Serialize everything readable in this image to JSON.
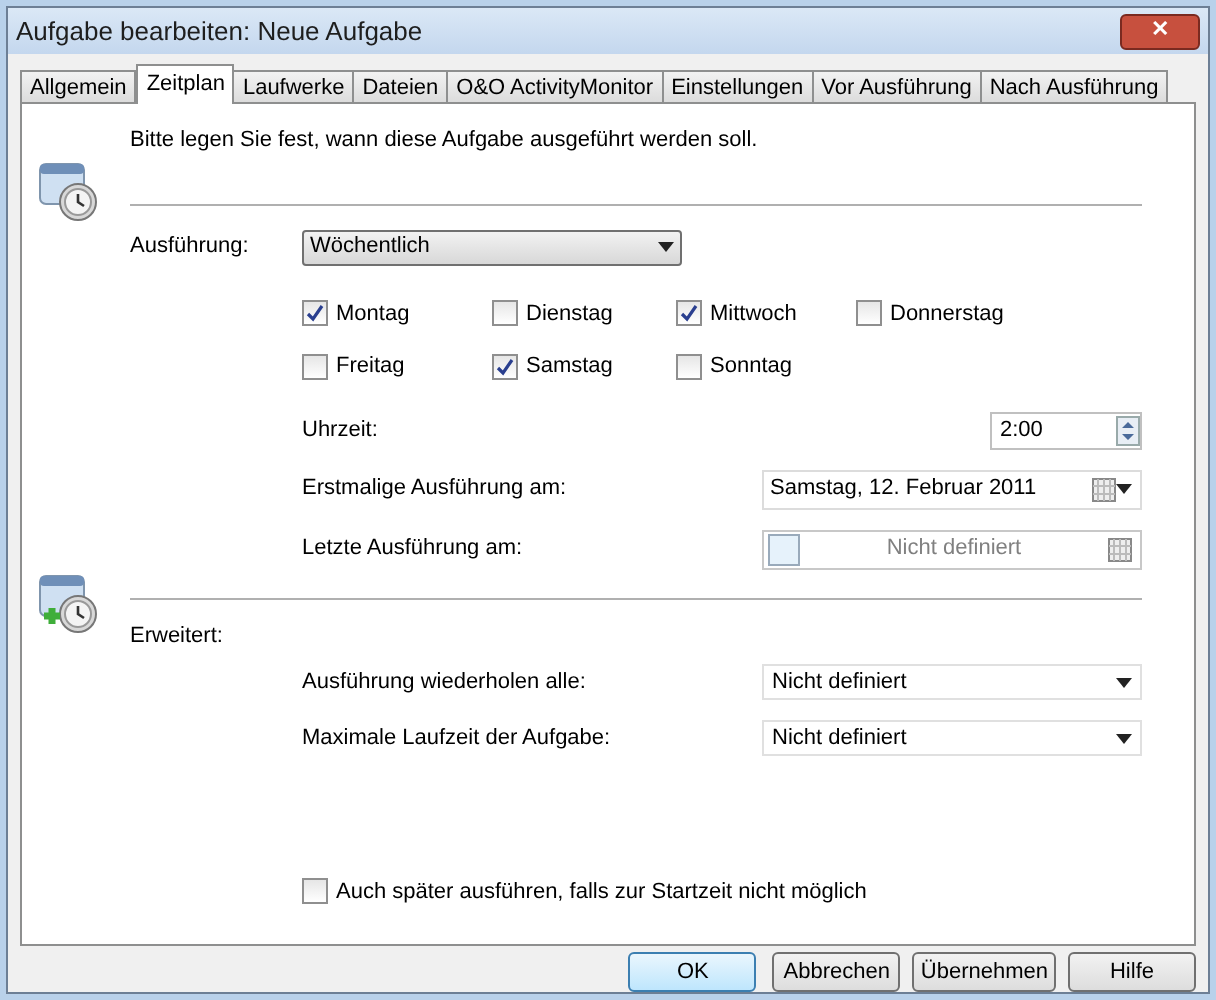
{
  "window": {
    "title": "Aufgabe bearbeiten: Neue Aufgabe",
    "close": "✕"
  },
  "tabs": [
    {
      "label": "Allgemein",
      "selected": false
    },
    {
      "label": "Zeitplan",
      "selected": true
    },
    {
      "label": "Laufwerke",
      "selected": false
    },
    {
      "label": "Dateien",
      "selected": false
    },
    {
      "label": "O&O ActivityMonitor",
      "selected": false
    },
    {
      "label": "Einstellungen",
      "selected": false
    },
    {
      "label": "Vor Ausführung",
      "selected": false
    },
    {
      "label": "Nach Ausführung",
      "selected": false
    }
  ],
  "intro": "Bitte legen Sie fest, wann diese Aufgabe ausgeführt werden soll.",
  "schedule": {
    "label": "Ausführung:",
    "value": "Wöchentlich"
  },
  "days": [
    [
      {
        "label": "Montag",
        "checked": true
      },
      {
        "label": "Dienstag",
        "checked": false
      },
      {
        "label": "Mittwoch",
        "checked": true
      },
      {
        "label": "Donnerstag",
        "checked": false
      }
    ],
    [
      {
        "label": "Freitag",
        "checked": false
      },
      {
        "label": "Samstag",
        "checked": true
      },
      {
        "label": "Sonntag",
        "checked": false
      }
    ]
  ],
  "time": {
    "label": "Uhrzeit:",
    "value": "2:00"
  },
  "first_run": {
    "label": "Erstmalige Ausführung am:",
    "value": "Samstag, 12. Februar 2011",
    "disabled": false
  },
  "last_run": {
    "label": "Letzte Ausführung am:",
    "value": "Nicht definiert",
    "disabled": true
  },
  "advanced": {
    "label": "Erweitert:",
    "rows": [
      {
        "label": "Ausführung wiederholen alle:",
        "value": "Nicht definiert"
      },
      {
        "label": "Maximale Laufzeit der Aufgabe:",
        "value": "Nicht definiert"
      }
    ]
  },
  "run_later": {
    "label": "Auch später ausführen, falls zur Startzeit nicht möglich",
    "checked": false
  },
  "buttons": [
    {
      "label": "OK",
      "default": true
    },
    {
      "label": "Abbrechen",
      "default": false
    },
    {
      "label": "Übernehmen",
      "default": false
    },
    {
      "label": "Hilfe",
      "default": false
    }
  ]
}
